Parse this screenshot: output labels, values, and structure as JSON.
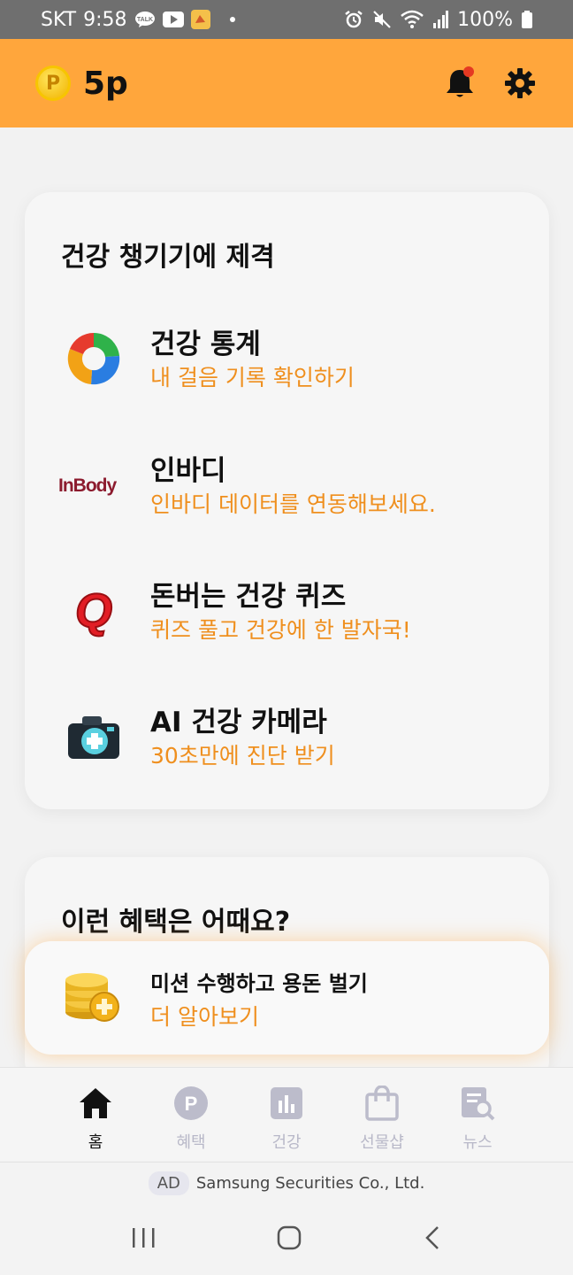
{
  "status_bar": {
    "carrier": "SKT",
    "time": "9:58",
    "kakao_badge": "TALK",
    "battery": "100%"
  },
  "header": {
    "coin_symbol": "P",
    "points": "5p",
    "icons": [
      "bell-icon",
      "gear-icon"
    ]
  },
  "health_card": {
    "title": "건강 챙기기에 제격",
    "items": [
      {
        "title": "건강 통계",
        "subtitle": "내 걸음 기록 확인하기",
        "icon": "pie-chart-icon"
      },
      {
        "title": "인바디",
        "subtitle": "인바디 데이터를 연동해보세요.",
        "icon": "inbody-logo",
        "logo_text": "InBody"
      },
      {
        "title": "돈버는 건강 퀴즈",
        "subtitle": "퀴즈 풀고 건강에 한 발자국!",
        "icon": "quiz-q-icon",
        "glyph": "Q"
      },
      {
        "title": "AI 건강 카메라",
        "subtitle": "30초만에 진단 받기",
        "icon": "medical-camera-icon"
      }
    ]
  },
  "benefits_card": {
    "title": "이런 혜택은 어때요?",
    "mission": {
      "title": "미션 수행하고 용돈 벌기",
      "subtitle": "더 알아보기",
      "icon": "coin-stack-icon"
    }
  },
  "bottom_nav": {
    "items": [
      {
        "label": "홈",
        "icon": "home-icon",
        "active": true
      },
      {
        "label": "혜택",
        "icon": "point-icon",
        "glyph": "P"
      },
      {
        "label": "건강",
        "icon": "bar-chart-icon"
      },
      {
        "label": "선물샵",
        "icon": "shopping-bag-icon"
      },
      {
        "label": "뉴스",
        "icon": "news-search-icon"
      }
    ]
  },
  "ad_bar": {
    "badge": "AD",
    "text": "Samsung Securities Co., Ltd."
  },
  "colors": {
    "accent": "#ffa63c",
    "subtitle": "#ef8f1e",
    "status_bar": "#6f6f6f"
  }
}
